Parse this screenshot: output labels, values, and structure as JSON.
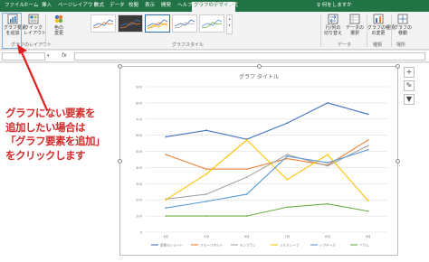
{
  "ribbon_tabs": [
    {
      "label": "ファイル"
    },
    {
      "label": "ホーム"
    },
    {
      "label": "挿入"
    },
    {
      "label": "ページレイアウト"
    },
    {
      "label": "数式"
    },
    {
      "label": "データ"
    },
    {
      "label": "校閲"
    },
    {
      "label": "表示"
    },
    {
      "label": "開発"
    },
    {
      "label": "ヘルプ"
    },
    {
      "label": "グラフのデザイン"
    },
    {
      "label": "書式"
    }
  ],
  "tell_me": "何をしますか",
  "ribbon": {
    "add_element_line1": "グラフ要素",
    "add_element_line2": "を追加",
    "quick_layout_line1": "クイック",
    "quick_layout_line2": "レイアウト",
    "colors_line1": "色の",
    "colors_line2": "変更",
    "layouts_group": "グラフのレイアウト",
    "styles_group": "グラフスタイル",
    "switch_row_col_line1": "行/列の",
    "switch_row_col_line2": "切り替え",
    "select_data_line1": "データの",
    "select_data_line2": "選択",
    "data_group": "データ",
    "change_type_line1": "グラフの種類",
    "change_type_line2": "の変更",
    "type_group": "種類",
    "move_chart_line1": "グラフの",
    "move_chart_line2": "移動",
    "location_group": "場所"
  },
  "formula": {
    "fx": "fx"
  },
  "chart_data": {
    "type": "line",
    "title": "グラフ タイトル",
    "categories": [
      "4月",
      "5月",
      "6月",
      "7月",
      "8月",
      "9月"
    ],
    "ylim": [
      0,
      900
    ],
    "yticks": [
      0,
      100,
      200,
      300,
      400,
      500,
      600,
      700,
      800,
      900
    ],
    "grid": true,
    "legend_position": "bottom",
    "series": [
      {
        "name": "季節のショート",
        "color": "#4472c4",
        "values": [
          590,
          630,
          575,
          675,
          800,
          730
        ]
      },
      {
        "name": "フルーツタルト",
        "color": "#ed7d31",
        "values": [
          480,
          390,
          390,
          455,
          415,
          570
        ]
      },
      {
        "name": "モンブラン",
        "color": "#a5a5a5",
        "values": [
          205,
          235,
          340,
          480,
          410,
          535
        ]
      },
      {
        "name": "ミルクレープ",
        "color": "#ffc000",
        "values": [
          200,
          360,
          570,
          325,
          480,
          195
        ]
      },
      {
        "name": "レアチーズ",
        "color": "#5b9bd5",
        "values": [
          150,
          190,
          235,
          470,
          430,
          510
        ]
      },
      {
        "name": "バウム",
        "color": "#70ad47",
        "values": [
          100,
          100,
          100,
          155,
          175,
          130
        ]
      }
    ]
  },
  "annotation": {
    "line1": "グラフにない要素を",
    "line2": "追加したい場合は",
    "line3": "「グラフ要素を追加」",
    "line4": "をクリックします"
  }
}
